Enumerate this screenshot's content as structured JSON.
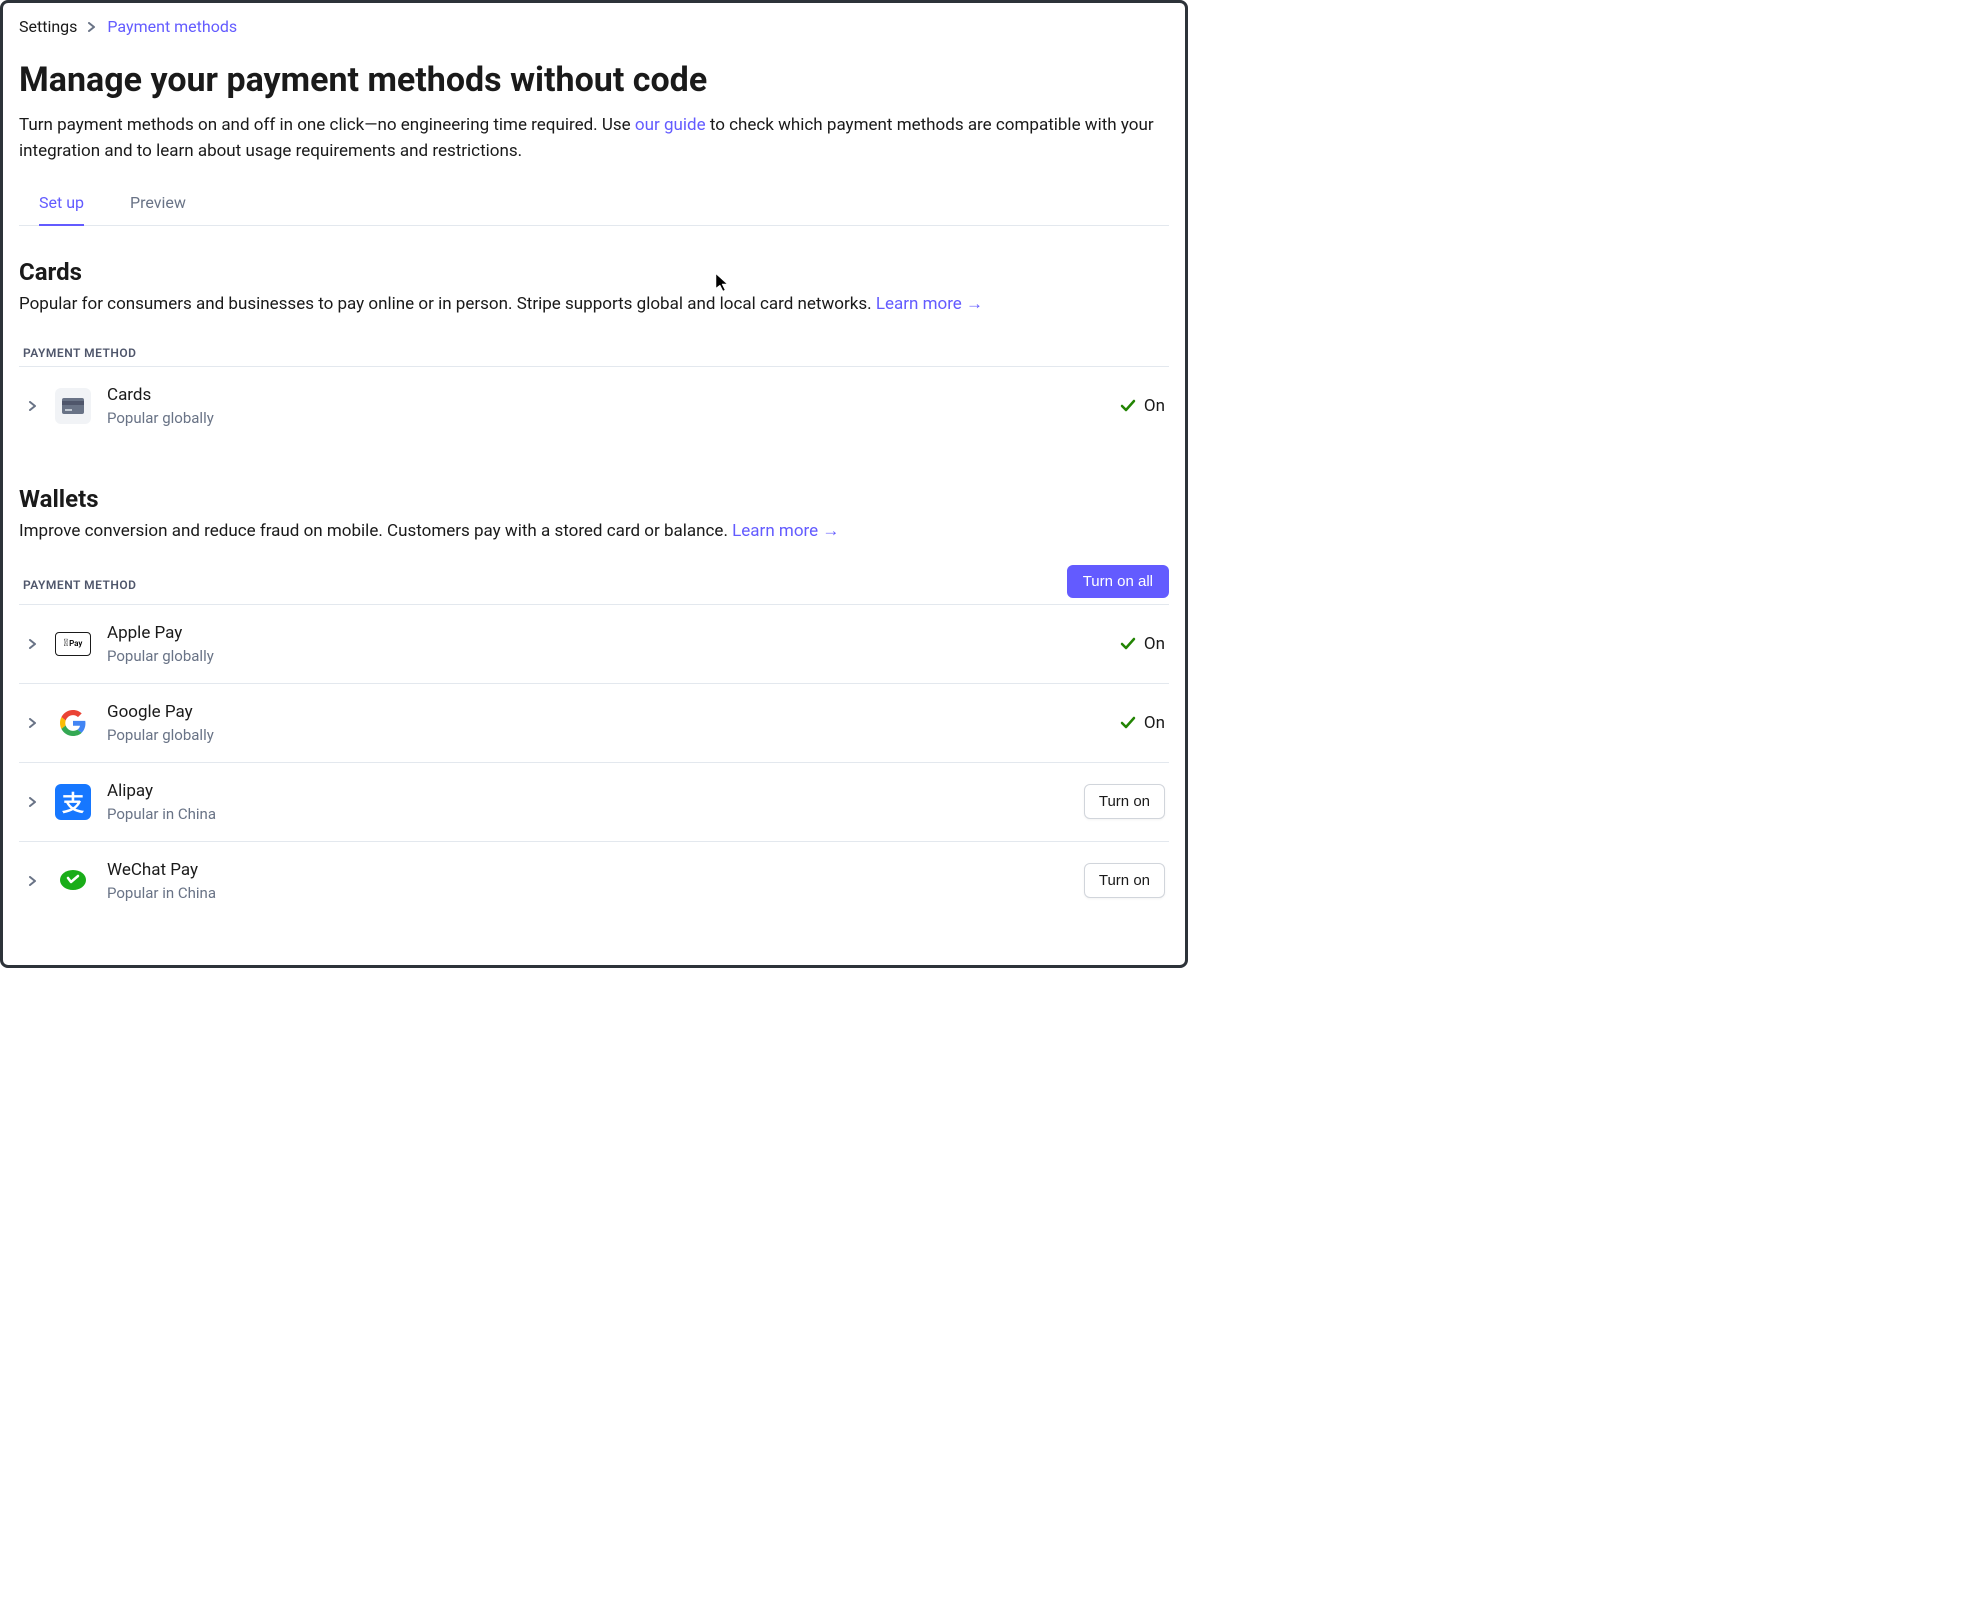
{
  "breadcrumb": {
    "parent": "Settings",
    "current": "Payment methods"
  },
  "header": {
    "title": "Manage your payment methods without code",
    "subtitle_before": "Turn payment methods on and off in one click—no engineering time required. Use ",
    "subtitle_link": "our guide",
    "subtitle_after": " to check which payment methods are compatible with your integration and to learn about usage requirements and restrictions."
  },
  "tabs": {
    "setup": "Set up",
    "preview": "Preview",
    "active": "setup"
  },
  "labels": {
    "payment_method_header": "PAYMENT METHOD",
    "turn_on_all": "Turn on all",
    "turn_on": "Turn on",
    "on": "On",
    "learn_more": "Learn more →"
  },
  "sections": {
    "cards": {
      "title": "Cards",
      "desc": "Popular for consumers and businesses to pay online or in person. Stripe supports global and local card networks. "
    },
    "wallets": {
      "title": "Wallets",
      "desc": "Improve conversion and reduce fraud on mobile. Customers pay with a stored card or balance. "
    }
  },
  "methods": {
    "cards": {
      "name": "Cards",
      "popular": "Popular globally",
      "status": "on"
    },
    "apple_pay": {
      "name": "Apple Pay",
      "popular": "Popular globally",
      "status": "on"
    },
    "google_pay": {
      "name": "Google Pay",
      "popular": "Popular globally",
      "status": "on"
    },
    "alipay": {
      "name": "Alipay",
      "popular": "Popular in China",
      "status": "off"
    },
    "wechat_pay": {
      "name": "WeChat Pay",
      "popular": "Popular in China",
      "status": "off"
    }
  }
}
